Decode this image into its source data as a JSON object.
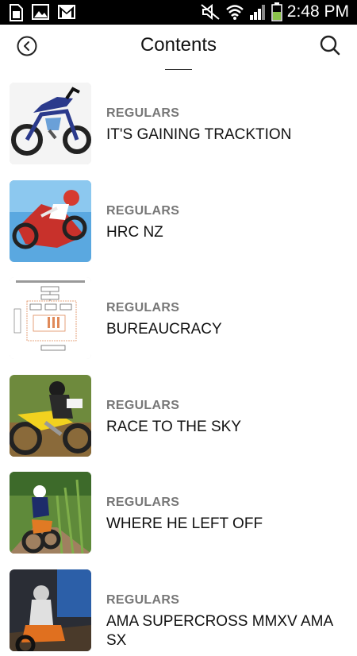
{
  "status_bar": {
    "time": "2:48 PM",
    "left_icons": [
      "sim-card-icon",
      "image-icon",
      "gmail-icon"
    ],
    "right_icons": [
      "mute-icon",
      "wifi-icon",
      "signal-icon",
      "battery-icon"
    ]
  },
  "header": {
    "title": "Contents",
    "back_icon": "back-circle-icon",
    "search_icon": "search-icon"
  },
  "items": [
    {
      "category": "REGULARS",
      "title": "IT'S GAINING TRACKTION",
      "thumb": "motorbike-photo"
    },
    {
      "category": "REGULARS",
      "title": "HRC NZ",
      "thumb": "rider-jump-photo"
    },
    {
      "category": "REGULARS",
      "title": "BUREAUCRACY",
      "thumb": "flowchart-document"
    },
    {
      "category": "REGULARS",
      "title": "RACE TO THE SKY",
      "thumb": "yellow-bike-photo"
    },
    {
      "category": "REGULARS",
      "title": "WHERE HE LEFT OFF",
      "thumb": "field-rider-photo"
    },
    {
      "category": "REGULARS",
      "title": "AMA SUPERCROSS MMXV AMA SX",
      "thumb": "supercross-photo"
    }
  ]
}
